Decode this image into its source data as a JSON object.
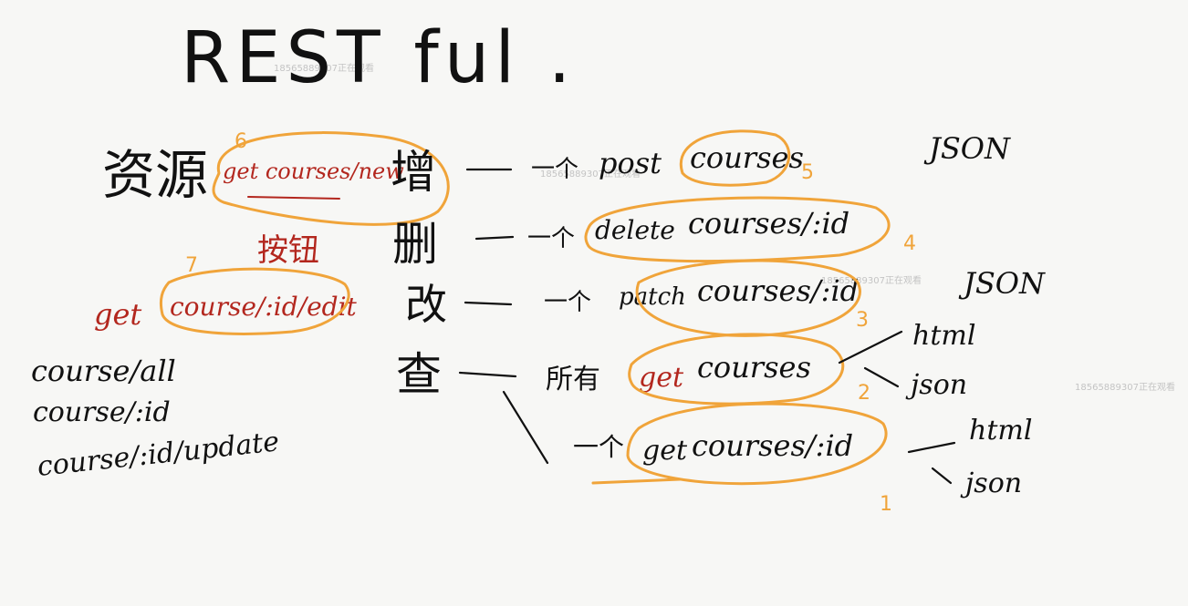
{
  "title": "REST ful .",
  "resource_label": "资源",
  "new_route": "get courses/new",
  "button_label": "按钮",
  "edit_route": {
    "method": "get",
    "path": "course/:id/edit"
  },
  "examples": [
    "course/all",
    "course/:id",
    "course/:id/update"
  ],
  "ops": [
    {
      "label": "增",
      "dash": "一个",
      "method": "post",
      "path": "courses",
      "num": "5"
    },
    {
      "label": "删",
      "dash": "一个",
      "method": "delete",
      "path": "courses/:id",
      "num": "4"
    },
    {
      "label": "改",
      "dash": "一个",
      "method": "patch",
      "path": "courses/:id",
      "num": "3"
    },
    {
      "label": "查",
      "dash": "所有",
      "method": "get",
      "path": "courses",
      "num": "2"
    },
    {
      "label": "",
      "dash": "一个",
      "method": "get",
      "path": "courses/:id",
      "num": "1"
    }
  ],
  "formats": {
    "json_top": "JSON",
    "json_mid": "JSON",
    "html1": "html",
    "json1": "json",
    "html2": "html",
    "json2": "json"
  },
  "side_nums": {
    "n6": "6",
    "n7": "7"
  },
  "watermarks": [
    "18565889307正在观看",
    "18565889307正在观看",
    "18565889307正在观看",
    "18565889307正在观看"
  ],
  "colors": {
    "background": "#f7f7f5",
    "ink": "#111111",
    "red_ink": "#b3271e",
    "orange_highlight": "#f0a43a"
  }
}
